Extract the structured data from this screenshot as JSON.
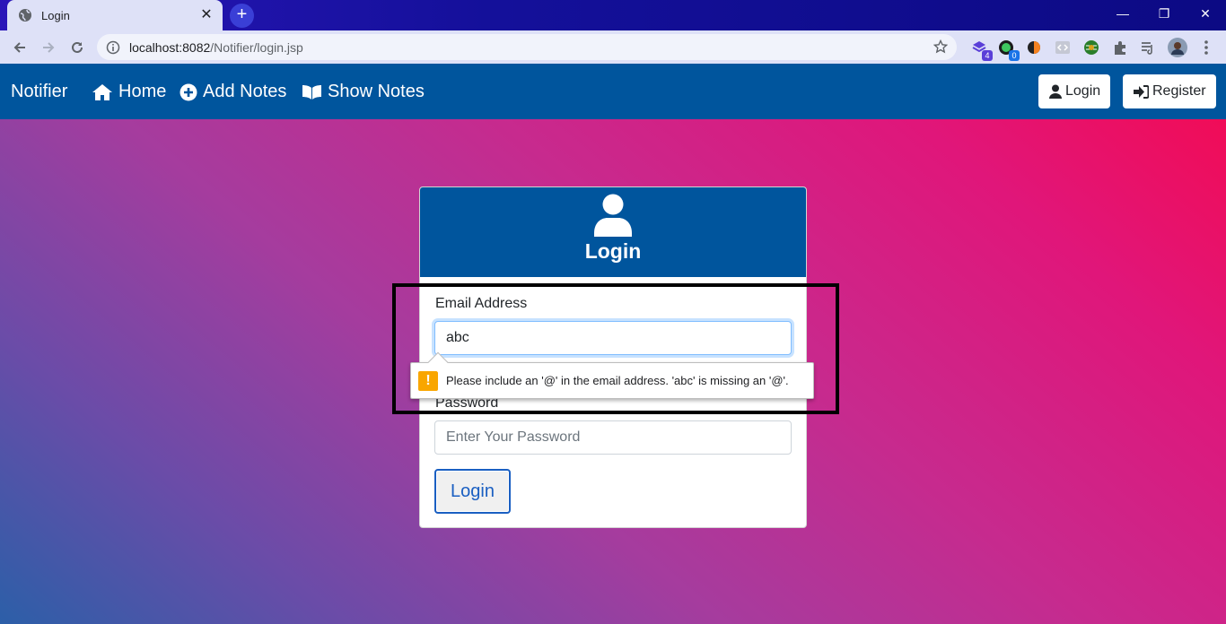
{
  "browser": {
    "tab_title": "Login",
    "tab_close": "✕",
    "new_tab": "+",
    "url_host": "localhost:8082",
    "url_path": "/Notifier/login.jsp",
    "extensions": [
      {
        "name": "ext-purple",
        "badge": "4",
        "badge_color": "#5a3fd8"
      },
      {
        "name": "ext-green-a",
        "badge": "0",
        "badge_color": "#1a73e8"
      }
    ],
    "window_controls": {
      "minimize": "—",
      "restore": "❐",
      "close": "✕"
    }
  },
  "nav": {
    "brand": "Notifier",
    "links": [
      {
        "label": "Home",
        "icon": "home-icon"
      },
      {
        "label": "Add Notes",
        "icon": "plus-circle-icon"
      },
      {
        "label": "Show Notes",
        "icon": "book-open-icon"
      }
    ],
    "login_label": "Login",
    "register_label": "Register"
  },
  "card": {
    "title": "Login",
    "email_label": "Email Address",
    "email_value": "abc",
    "password_label": "Password",
    "password_placeholder": "Enter Your Password",
    "submit_label": "Login"
  },
  "validation": {
    "message": "Please include an '@' in the email address. 'abc' is missing an '@'.",
    "icon": "!"
  },
  "colors": {
    "nav_bg": "#00559d",
    "accent": "#1a5fc2",
    "warning": "#f9a600"
  }
}
